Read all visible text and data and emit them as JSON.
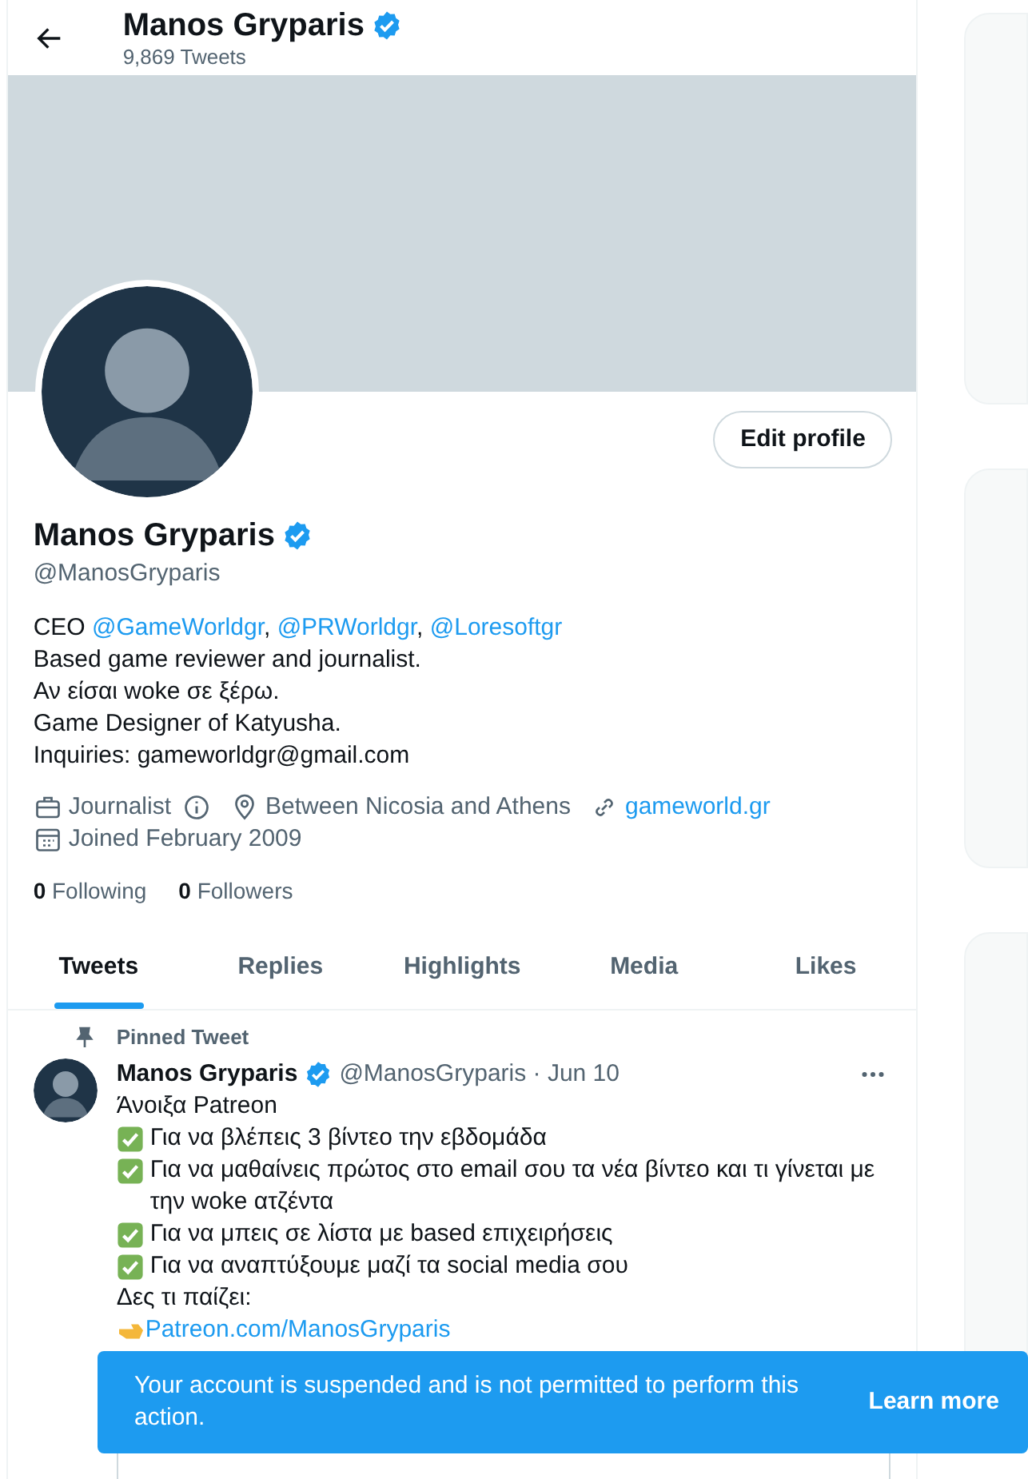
{
  "header": {
    "name": "Manos Gryparis",
    "verified": true,
    "tweet_count": "9,869 Tweets"
  },
  "profile": {
    "edit_button": "Edit profile",
    "name": "Manos Gryparis",
    "verified": true,
    "handle": "@ManosGryparis",
    "bio": [
      [
        {
          "text": "CEO "
        },
        {
          "text": "@GameWorldgr",
          "link": true
        },
        {
          "text": ", "
        },
        {
          "text": "@PRWorldgr",
          "link": true
        },
        {
          "text": ", "
        },
        {
          "text": "@Loresoftgr",
          "link": true
        }
      ],
      [
        {
          "text": "Based game reviewer and journalist."
        }
      ],
      [
        {
          "text": "Αν είσαι woke σε ξέρω."
        }
      ],
      [
        {
          "text": "Game Designer of Katyusha."
        }
      ],
      [
        {
          "text": "Inquiries: gameworldgr@gmail.com"
        }
      ]
    ],
    "meta": [
      {
        "kind": "work",
        "text": "Journalist"
      },
      {
        "kind": "location",
        "text": "Between Nicosia and Athens"
      },
      {
        "kind": "link",
        "text": "gameworld.gr"
      },
      {
        "kind": "joined",
        "text": "Joined February 2009"
      }
    ],
    "stats": [
      {
        "count": "0",
        "label": "Following"
      },
      {
        "count": "0",
        "label": "Followers"
      }
    ]
  },
  "tabs": [
    {
      "label": "Tweets",
      "selected": true
    },
    {
      "label": "Replies",
      "selected": false
    },
    {
      "label": "Highlights",
      "selected": false
    },
    {
      "label": "Media",
      "selected": false
    },
    {
      "label": "Likes",
      "selected": false
    }
  ],
  "pinned_tweet": {
    "pinned_label": "Pinned Tweet",
    "author": "Manos Gryparis",
    "verified": true,
    "handle_date": "@ManosGryparis · Jun 10",
    "lines": [
      {
        "kind": "text",
        "text": "Άνοιξα Patreon"
      },
      {
        "kind": "check",
        "text": "Για να βλέπεις 3 βίντεο την εβδομάδα"
      },
      {
        "kind": "check",
        "text": "Για να μαθαίνεις πρώτος στο email σου τα νέα βίντεο και τι γίνεται με την woke ατζέντα"
      },
      {
        "kind": "check",
        "text": "Για να μπεις σε λίστα με based επιχειρήσεις"
      },
      {
        "kind": "check",
        "text": "Για να αναπτύξουμε μαζί τα social media σου"
      },
      {
        "kind": "text",
        "text": "Δες τι παίζει:"
      },
      {
        "kind": "pointer-link",
        "text": "Patreon.com/ManosGryparis"
      }
    ]
  },
  "toast": {
    "message": "Your account is suspended and is not permitted to perform this action.",
    "action": "Learn more"
  }
}
